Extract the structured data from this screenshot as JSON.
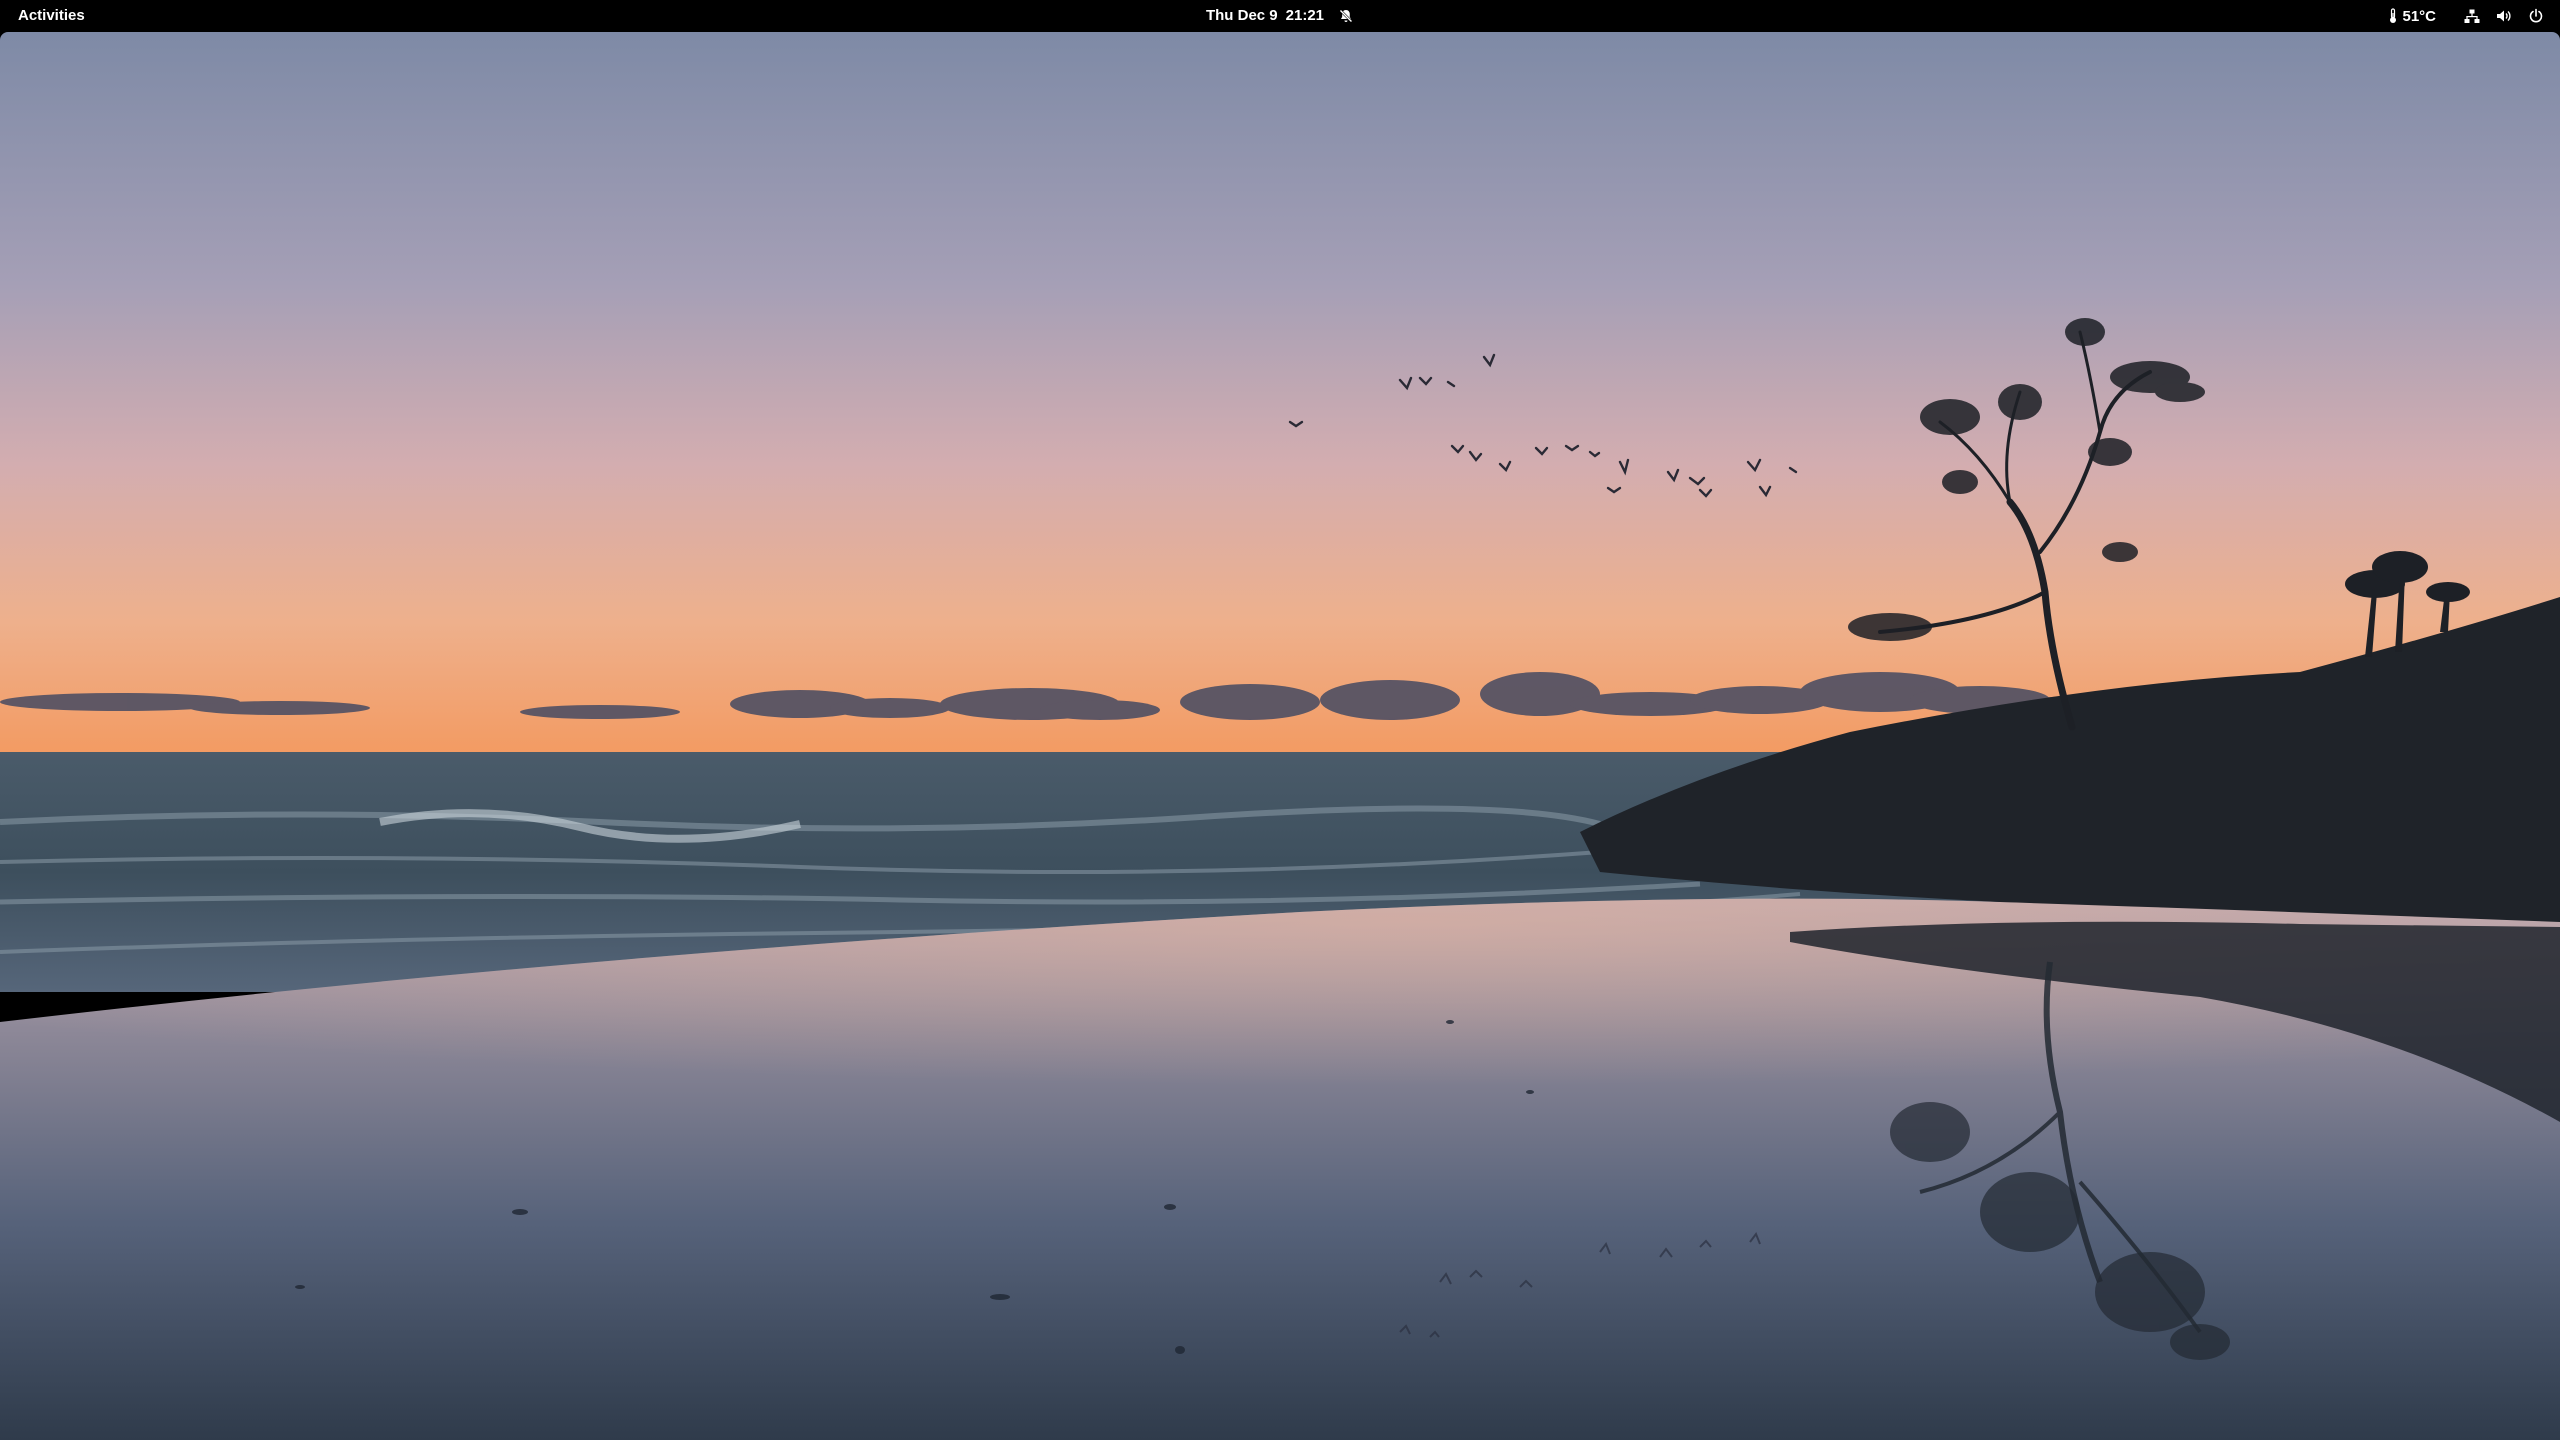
{
  "topbar": {
    "activities_label": "Activities",
    "date": "Thu Dec 9",
    "time": "21:21",
    "notification_icon": "notifications-disabled-icon",
    "temperature": "51°C",
    "tray_icons": [
      "thermometer-icon",
      "network-wired-icon",
      "volume-icon",
      "power-icon"
    ]
  },
  "wallpaper": {
    "description_icon": "beach-sunset-wallpaper",
    "colors": {
      "sky_top": "#7e8aa6",
      "sky_mid": "#cba8b0",
      "sky_horizon": "#f0a170",
      "sea": "#3f5260",
      "sand": "#3c4a59",
      "silhouette": "#1c2026"
    }
  }
}
